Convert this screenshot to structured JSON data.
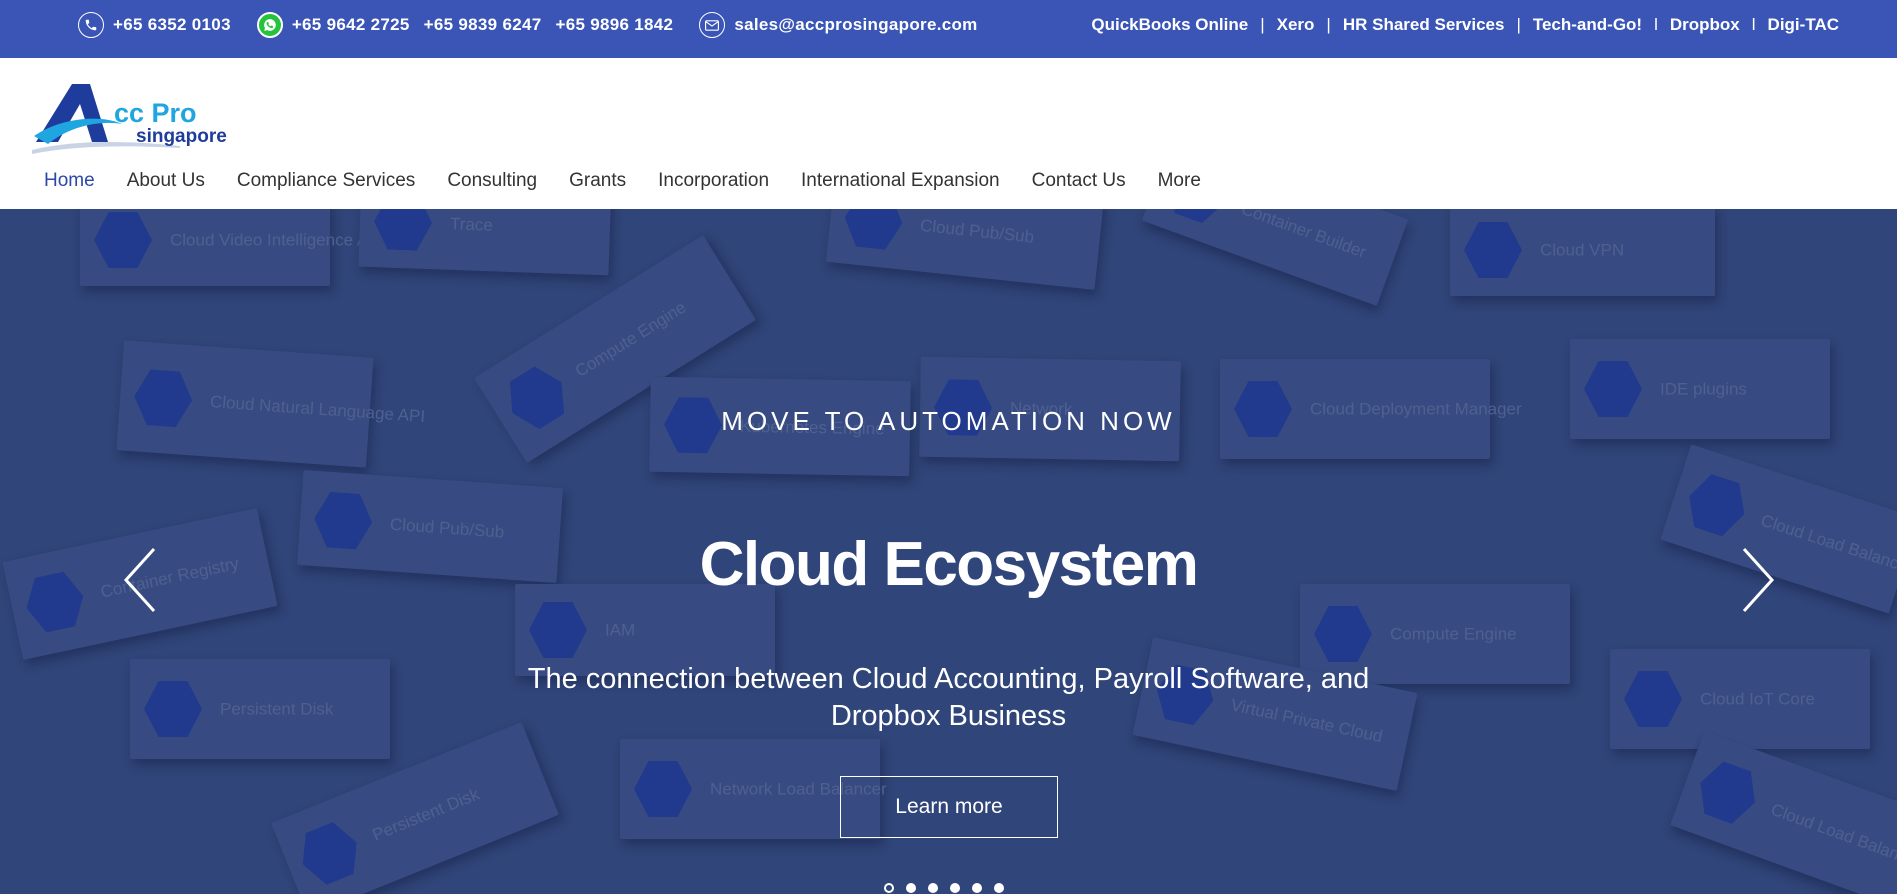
{
  "topbar": {
    "phone1": "+65 6352 0103",
    "whatsapp_numbers": [
      "+65 9642 2725",
      "+65 9839 6247",
      "+65 9896 1842"
    ],
    "email": "sales@accprosingapore.com",
    "links": [
      "QuickBooks Online",
      "Xero",
      "HR Shared Services",
      "Tech-and-Go!",
      "Dropbox",
      "Digi-TAC"
    ],
    "separators": [
      "|",
      "|",
      "|",
      "l",
      "l"
    ]
  },
  "logo": {
    "text_main": "cc Pro",
    "text_sub": "singapore",
    "colors": {
      "primary": "#1e3c9c",
      "accent": "#1fa6e0"
    }
  },
  "nav": {
    "items": [
      "Home",
      "About Us",
      "Compliance Services",
      "Consulting",
      "Grants",
      "Incorporation",
      "International Expansion",
      "Contact Us",
      "More"
    ],
    "active": "Home"
  },
  "hero": {
    "kicker": "MOVE TO AUTOMATION NOW",
    "title": "Cloud Ecosystem",
    "subtitle": "The connection between Cloud Accounting, Payroll Software, and Dropbox Business",
    "button": "Learn more",
    "slide_count": 6,
    "active_slide": 1,
    "background_tiles": [
      "Cloud Video Intelligence API",
      "Trace",
      "Cloud Pub/Sub",
      "Container Builder",
      "Cloud VPN",
      "Compute Engine",
      "Cloud Natural Language API",
      "Network",
      "Cloud Deployment Manager",
      "IDE plugins",
      "Kubernetes Engine",
      "Cloud Pub/Sub",
      "Cloud Load Balancing",
      "Container Registry",
      "IAM",
      "Compute Engine",
      "Persistent Disk",
      "Virtual Private Cloud",
      "Cloud IoT Core",
      "Cloud Load Balancing",
      "Persistent Disk",
      "Network Load Balancer"
    ]
  },
  "colors": {
    "topbar": "#3a55b5",
    "nav_active": "#2c47a8",
    "hero_bg": "#33487c",
    "whatsapp": "#25c23b"
  }
}
